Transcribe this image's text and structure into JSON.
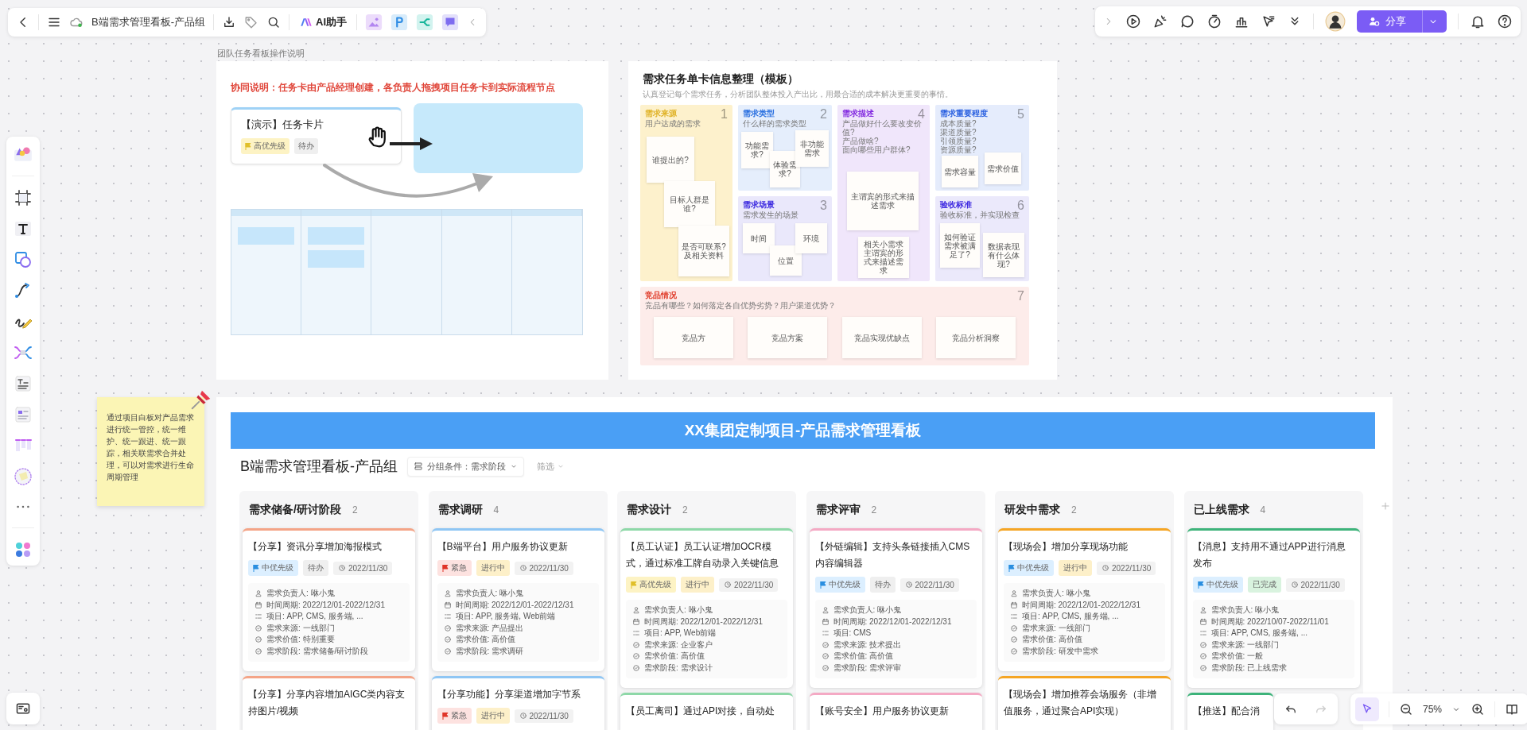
{
  "app_bar": {
    "title": "B端需求管理看板-产品组",
    "ai_button": "AI助手"
  },
  "share_button": {
    "label": "分享"
  },
  "frame_label": "团队任务看板操作说明",
  "guide": {
    "note": "协同说明：任务卡由产品经理创建，各负责人拖拽项目任务卡到实际流程节点",
    "demo_card": {
      "title": "【演示】任务卡片",
      "tags": [
        {
          "kind": "priority",
          "text": "高优先级",
          "color": "#fdf3c4"
        },
        {
          "kind": "status",
          "text": "待办",
          "color": "#efefef"
        }
      ]
    }
  },
  "template": {
    "title": "需求任务单卡信息整理（模板）",
    "subtitle": "认真登记每个需求任务，分析团队整体投入产出比，用最合适的成本解决更重要的事情。",
    "sections": [
      {
        "number": "1",
        "title": "需求来源",
        "hint": [
          "用户达成的需求"
        ],
        "color": "#fdf1cc",
        "notes": [
          "谁提出的?",
          "目标人群是谁?",
          "是否可联系? 及相关资料"
        ]
      },
      {
        "number": "2",
        "title": "需求类型",
        "hint": [
          "什么样的需求类型"
        ],
        "color": "#e5eefc",
        "notes": [
          "功能需求?",
          "体验需求?",
          "非功能需求"
        ]
      },
      {
        "number": "3",
        "title": "需求场景",
        "hint": [
          "需求发生的场景"
        ],
        "color": "#eae8fb",
        "notes": [
          "时间",
          "位置",
          "环境"
        ]
      },
      {
        "number": "4",
        "title": "需求描述",
        "hint": [
          "产品做好什么要改变价值?",
          "产品做啥?",
          "面向哪些用户群体?"
        ],
        "color": "#f0e6fb",
        "notes": [
          "主谓宾的形式来描述需求",
          "相关小需求主谓宾的形式来描述需求"
        ]
      },
      {
        "number": "5",
        "title": "需求重要程度",
        "hint": [
          "成本质量?",
          "渠道质量?",
          "引领质量?",
          "资源质量?"
        ],
        "color": "#e5ecfc",
        "notes": [
          "需求容量",
          "需求价值"
        ]
      },
      {
        "number": "6",
        "title": "验收标准",
        "hint": [
          "验收标准，并实现检查"
        ],
        "color": "#ebe9fb",
        "notes": [
          "如何验证需求被满足了?",
          "数据表现有什么体现?"
        ]
      },
      {
        "number": "7",
        "title": "竞品情况",
        "hint": [
          "竞品有哪些？如何落定各自优势劣势？用户渠道优势？"
        ],
        "color": "#fdecea",
        "notes": [
          "竞品方",
          "竞品方案",
          "竞品实现优缺点",
          "竞品分析洞察"
        ]
      }
    ]
  },
  "sticky_note": {
    "text": "通过项目白板对产品需求进行统一管控，统一维护、统一跟进、统一跟踪，相关联需求合并处理，可以对需求进行生命周期管理"
  },
  "board": {
    "banner": "XX集团定制项目-产品需求管理看板",
    "title": "B端需求管理看板-产品组",
    "group_by": "分组条件：需求阶段",
    "filter": "筛选",
    "columns": [
      {
        "title": "需求储备/研讨阶段",
        "count": "2",
        "cards": [
          {
            "title": "【分享】资讯分享增加海报模式",
            "color": "#f4a487",
            "tags": [
              {
                "kind": "priority",
                "text": "中优先级",
                "color": "#dcefff"
              },
              {
                "kind": "status",
                "text": "待办",
                "color": "#efefef"
              }
            ],
            "due": "2022/11/30",
            "fields": [
              {
                "kind": "person",
                "text": "需求负责人: 咻小鬼"
              },
              {
                "kind": "calendar",
                "text": "时间周期: 2022/12/01-2022/12/31"
              },
              {
                "kind": "list",
                "text": "项目: APP, CMS, 服务端, ..."
              },
              {
                "kind": "check",
                "text": "需求来源: 一线部门"
              },
              {
                "kind": "check",
                "text": "需求价值: 特别重要"
              },
              {
                "kind": "check",
                "text": "需求阶段: 需求储备/研讨阶段"
              }
            ]
          },
          {
            "title": "【分享】分享内容增加AIGC类内容支持图片/视频",
            "color": "#f4a487"
          }
        ]
      },
      {
        "title": "需求调研",
        "count": "4",
        "cards": [
          {
            "title": "【B端平台】用户服务协议更新",
            "color": "#8fc6f4",
            "tags": [
              {
                "kind": "priority",
                "text": "紧急",
                "color": "#fde2e0"
              },
              {
                "kind": "status",
                "text": "进行中",
                "color": "#fdf0c9"
              }
            ],
            "due": "2022/11/30",
            "fields": [
              {
                "kind": "person",
                "text": "需求负责人: 咻小鬼"
              },
              {
                "kind": "calendar",
                "text": "时间周期: 2022/12/01-2022/12/31"
              },
              {
                "kind": "list",
                "text": "项目: APP, 服务端, Web前端"
              },
              {
                "kind": "check",
                "text": "需求来源: 产品提出"
              },
              {
                "kind": "check",
                "text": "需求价值: 高价值"
              },
              {
                "kind": "check",
                "text": "需求阶段: 需求调研"
              }
            ]
          },
          {
            "title": "【分享功能】分享渠道增加字节系",
            "color": "#8fc6f4",
            "tags": [
              {
                "kind": "priority",
                "text": "紧急",
                "color": "#fde2e0"
              },
              {
                "kind": "status",
                "text": "进行中",
                "color": "#fdf0c9"
              }
            ],
            "due": "2022/11/30"
          }
        ]
      },
      {
        "title": "需求设计",
        "count": "2",
        "cards": [
          {
            "title": "【员工认证】员工认证增加OCR模式，通过标准工牌自动录入关键信息",
            "color": "#8ed8a8",
            "tags": [
              {
                "kind": "priority",
                "text": "高优先级",
                "color": "#fdf3c4"
              },
              {
                "kind": "status",
                "text": "进行中",
                "color": "#fdf0c9"
              }
            ],
            "due": "2022/11/30",
            "fields": [
              {
                "kind": "person",
                "text": "需求负责人: 咻小鬼"
              },
              {
                "kind": "calendar",
                "text": "时间周期: 2022/12/01-2022/12/31"
              },
              {
                "kind": "list",
                "text": "项目: APP, Web前端"
              },
              {
                "kind": "check",
                "text": "需求来源: 企业客户"
              },
              {
                "kind": "check",
                "text": "需求价值: 高价值"
              },
              {
                "kind": "check",
                "text": "需求阶段: 需求设计"
              }
            ]
          },
          {
            "title": "【员工离司】通过API对接，自动处",
            "color": "#8ed8a8"
          }
        ]
      },
      {
        "title": "需求评审",
        "count": "2",
        "cards": [
          {
            "title": "【外链编辑】支持头条链接插入CMS内容编辑器",
            "color": "#f4a9c4",
            "tags": [
              {
                "kind": "priority",
                "text": "中优先级",
                "color": "#dcefff"
              },
              {
                "kind": "status",
                "text": "待办",
                "color": "#efefef"
              }
            ],
            "due": "2022/11/30",
            "fields": [
              {
                "kind": "person",
                "text": "需求负责人: 咻小鬼"
              },
              {
                "kind": "calendar",
                "text": "时间周期: 2022/12/01-2022/12/31"
              },
              {
                "kind": "list",
                "text": "项目: CMS"
              },
              {
                "kind": "check",
                "text": "需求来源: 技术提出"
              },
              {
                "kind": "check",
                "text": "需求价值: 高价值"
              },
              {
                "kind": "check",
                "text": "需求阶段: 需求评审"
              }
            ]
          },
          {
            "title": "【账号安全】用户服务协议更新",
            "color": "#f4a9c4"
          }
        ]
      },
      {
        "title": "研发中需求",
        "count": "2",
        "cards": [
          {
            "title": "【现场会】增加分享现场功能",
            "color": "#f5a524",
            "tags": [
              {
                "kind": "priority",
                "text": "中优先级",
                "color": "#dcefff"
              },
              {
                "kind": "status",
                "text": "进行中",
                "color": "#fdf0c9"
              }
            ],
            "due": "2022/11/30",
            "fields": [
              {
                "kind": "person",
                "text": "需求负责人: 咻小鬼"
              },
              {
                "kind": "calendar",
                "text": "时间周期: 2022/12/01-2022/12/31"
              },
              {
                "kind": "list",
                "text": "项目: APP, CMS, 服务端, ..."
              },
              {
                "kind": "check",
                "text": "需求来源: 一线部门"
              },
              {
                "kind": "check",
                "text": "需求价值: 高价值"
              },
              {
                "kind": "check",
                "text": "需求阶段: 研发中需求"
              }
            ]
          },
          {
            "title": "【现场会】增加推荐会场服务（非增值服务，通过聚合API实现）",
            "color": "#f5a524"
          }
        ]
      },
      {
        "title": "已上线需求",
        "count": "4",
        "cards": [
          {
            "title": "【消息】支持用不通过APP进行消息发布",
            "color": "#3db37a",
            "tags": [
              {
                "kind": "priority",
                "text": "中优先级",
                "color": "#dcefff"
              },
              {
                "kind": "status",
                "text": "已完成",
                "color": "#d9f3df"
              }
            ],
            "due": "2022/11/30",
            "fields": [
              {
                "kind": "person",
                "text": "需求负责人: 咻小鬼"
              },
              {
                "kind": "calendar",
                "text": "时间周期: 2022/10/07-2022/11/01"
              },
              {
                "kind": "list",
                "text": "项目: APP, CMS, 服务端, ..."
              },
              {
                "kind": "check",
                "text": "需求来源: 一线部门"
              },
              {
                "kind": "check",
                "text": "需求价值: 一般"
              },
              {
                "kind": "check",
                "text": "需求阶段: 已上线需求"
              }
            ]
          },
          {
            "title": "【推送】配合消",
            "color": "#3db37a"
          }
        ]
      }
    ]
  },
  "canvas_controls": {
    "history": [
      {
        "kind": "undo",
        "disabled": false
      },
      {
        "kind": "redo",
        "disabled": true
      }
    ],
    "pointer": {
      "selected": true
    },
    "zoom": "75%"
  }
}
